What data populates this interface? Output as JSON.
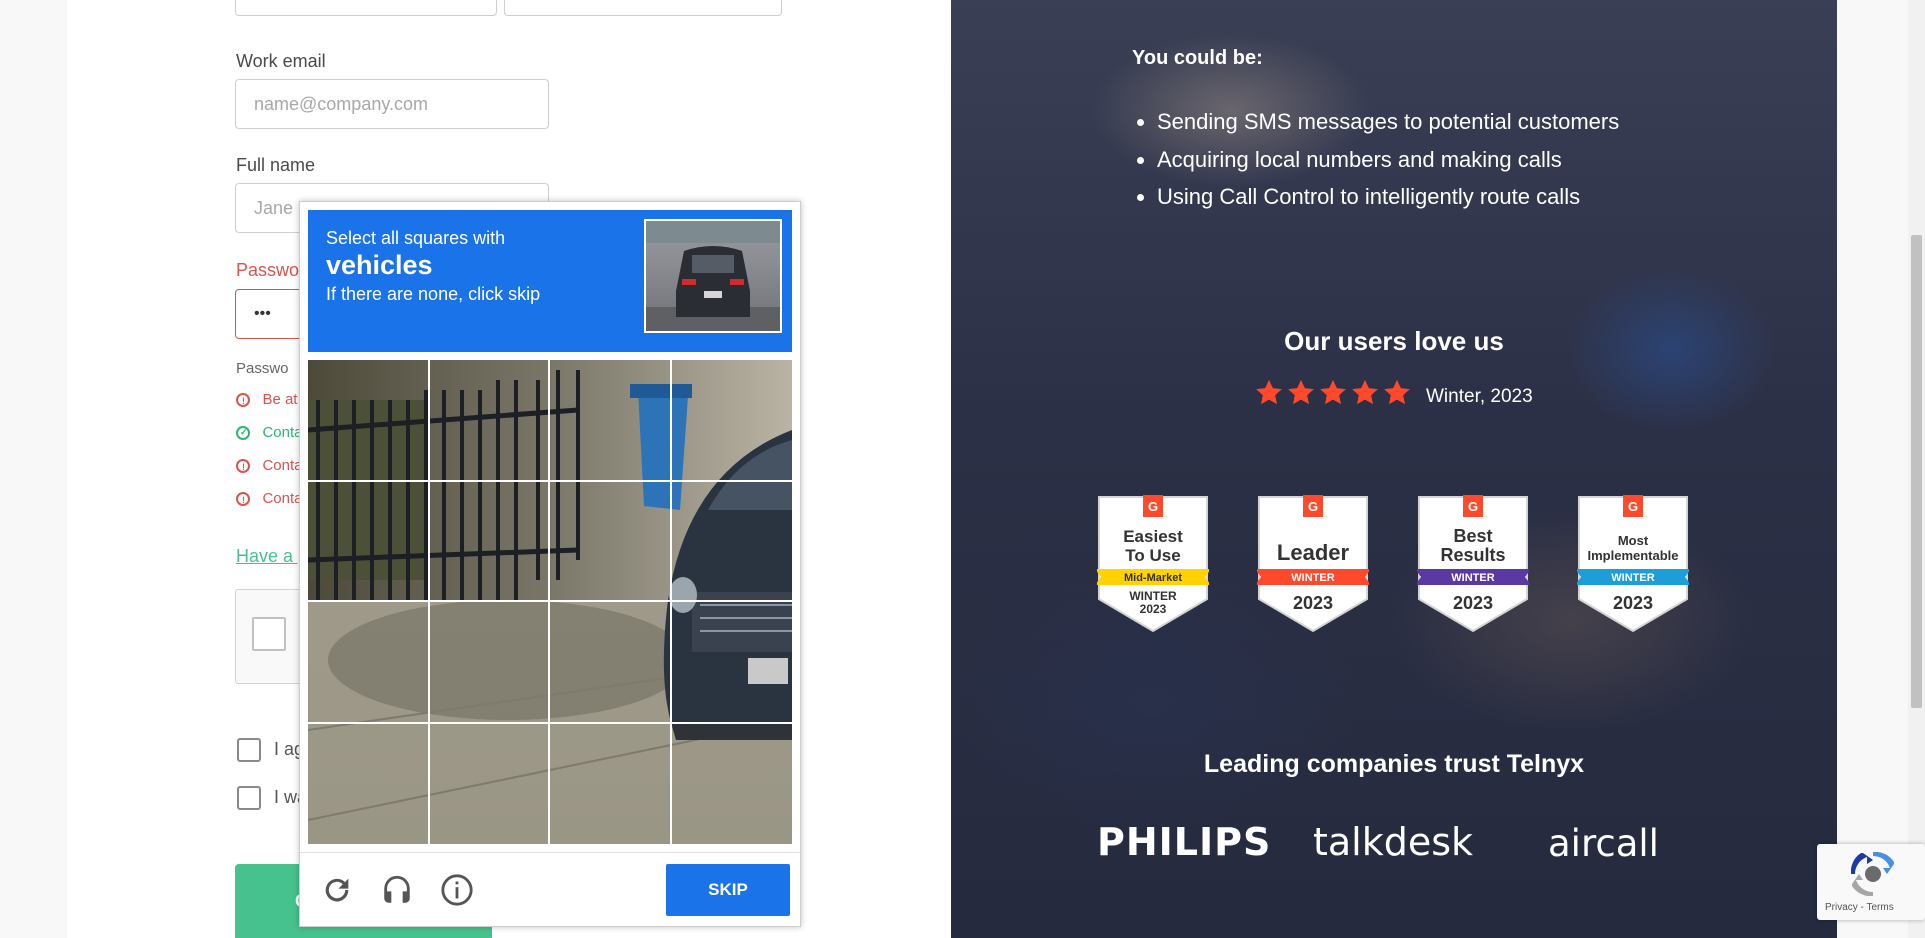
{
  "form": {
    "work_email_label": "Work email",
    "work_email_placeholder": "name@company.com",
    "full_name_label": "Full name",
    "full_name_placeholder": "Jane",
    "password_label": "Passwo",
    "password_value": "•••",
    "password_hint_label": "Passwo",
    "requirements": [
      {
        "text": "Be at",
        "status": "unmet"
      },
      {
        "text": "Conta",
        "status": "met"
      },
      {
        "text": "Conta",
        "status": "unmet"
      },
      {
        "text": "Conta",
        "status": "unmet"
      }
    ],
    "have_promo_link": "Have a p",
    "agree_label_1": "I ag",
    "agree_label_2": "I wa",
    "submit_label": "C"
  },
  "captcha": {
    "instruction_top": "Select all squares with",
    "target_word": "vehicles",
    "instruction_bottom": "If there are none, click skip",
    "skip_label": "SKIP",
    "icons": [
      "reload-icon",
      "audio-headphones-icon",
      "info-icon"
    ],
    "grid_size": 4,
    "header_color": "#1a73e8"
  },
  "hero": {
    "intro": "You could be:",
    "bullets": [
      "Sending SMS messages to potential customers",
      "Acquiring local numbers and making calls",
      "Using Call Control to intelligently route calls"
    ],
    "love_heading": "Our users love us",
    "rating_stars": 5,
    "rating_label": "Winter, 2023",
    "star_color": "#ff492c",
    "badges": [
      {
        "title_lines": [
          "Easiest",
          "To Use"
        ],
        "ribbon": "Mid-Market",
        "ribbon_color": "#ffd200",
        "ribbon_text_color": "#333333",
        "footer_lines": [
          "WINTER",
          "2023"
        ]
      },
      {
        "title_lines": [
          "Leader"
        ],
        "ribbon": "WINTER",
        "ribbon_color": "#ff492c",
        "ribbon_text_color": "#ffffff",
        "footer_lines": [
          "2023"
        ]
      },
      {
        "title_lines": [
          "Best",
          "Results"
        ],
        "ribbon": "WINTER",
        "ribbon_color": "#5a39a3",
        "ribbon_text_color": "#ffffff",
        "footer_lines": [
          "2023"
        ]
      },
      {
        "title_lines": [
          "Most",
          "Implementable"
        ],
        "ribbon": "WINTER",
        "ribbon_color": "#1c9ed9",
        "ribbon_text_color": "#ffffff",
        "footer_lines": [
          "2023"
        ]
      }
    ],
    "trust_heading": "Leading companies trust Telnyx",
    "logos": [
      "PHILIPS",
      "talkdesk",
      "aircall"
    ]
  },
  "recaptcha_badge": {
    "links": "Privacy - Terms"
  },
  "colors": {
    "accent_green": "#46c28e",
    "error_red": "#d9534f",
    "success_green": "#2bb673",
    "captcha_blue": "#1a73e8"
  }
}
